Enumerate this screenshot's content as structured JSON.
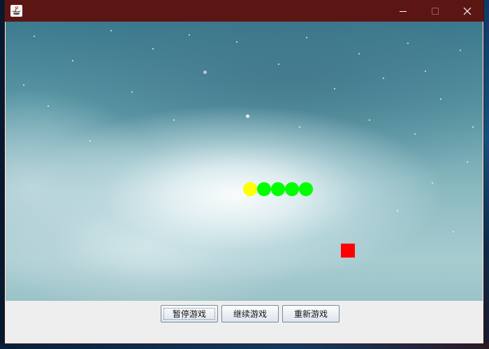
{
  "window": {
    "title": "",
    "titlebar_color": "#5b1614",
    "icons": {
      "app": "java-app-icon",
      "minimize": "minimize-icon",
      "maximize": "maximize-icon",
      "close": "close-icon"
    }
  },
  "game": {
    "background": "starry-nebula-scene",
    "snake": {
      "head_color": "#ffff00",
      "body_color": "#00ff00",
      "segments": [
        {
          "col": 17,
          "row": 12,
          "part": "head"
        },
        {
          "col": 18,
          "row": 12,
          "part": "body"
        },
        {
          "col": 19,
          "row": 12,
          "part": "body"
        },
        {
          "col": 20,
          "row": 12,
          "part": "body"
        },
        {
          "col": 21,
          "row": 12,
          "part": "body"
        }
      ]
    },
    "food": {
      "col": 24,
      "row": 16,
      "color": "#ff0000"
    }
  },
  "controls": {
    "pause_label": "暂停游戏",
    "resume_label": "继续游戏",
    "restart_label": "重新游戏"
  }
}
